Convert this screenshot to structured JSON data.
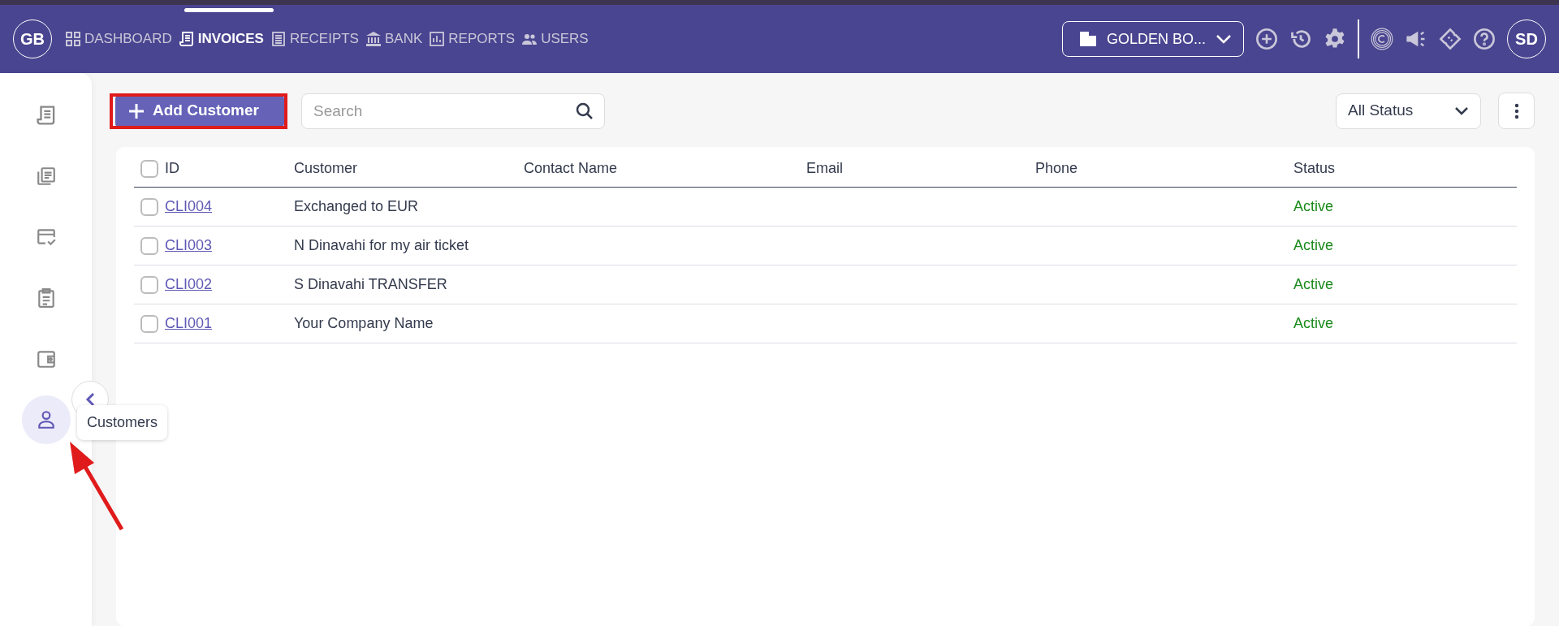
{
  "brand": {
    "initials": "GB"
  },
  "nav": [
    {
      "label": "DASHBOARD",
      "selected": false
    },
    {
      "label": "INVOICES",
      "selected": true
    },
    {
      "label": "RECEIPTS",
      "selected": false
    },
    {
      "label": "BANK",
      "selected": false
    },
    {
      "label": "REPORTS",
      "selected": false
    },
    {
      "label": "USERS",
      "selected": false
    }
  ],
  "company": {
    "name": "GOLDEN BO..."
  },
  "user": {
    "initials": "SD"
  },
  "sidebar": {
    "items": [
      {
        "selected": false
      },
      {
        "selected": false
      },
      {
        "selected": false
      },
      {
        "selected": false
      },
      {
        "selected": false
      },
      {
        "selected": true
      }
    ],
    "tooltip": "Customers"
  },
  "toolbar": {
    "add_button": "Add Customer",
    "search": {
      "placeholder": "Search"
    },
    "status_filter": "All Status"
  },
  "table": {
    "columns": [
      "ID",
      "Customer",
      "Contact Name",
      "Email",
      "Phone",
      "Status"
    ],
    "header_checked": false,
    "rows": [
      {
        "id": "CLI004",
        "customer": "Exchanged to EUR",
        "status": "Active",
        "checked": false
      },
      {
        "id": "CLI003",
        "customer": "N Dinavahi for my air ticket",
        "status": "Active",
        "checked": false
      },
      {
        "id": "CLI002",
        "customer": "S Dinavahi TRANSFER",
        "status": "Active",
        "checked": false
      },
      {
        "id": "CLI001",
        "customer": "Your Company Name",
        "status": "Active",
        "checked": false
      }
    ]
  }
}
